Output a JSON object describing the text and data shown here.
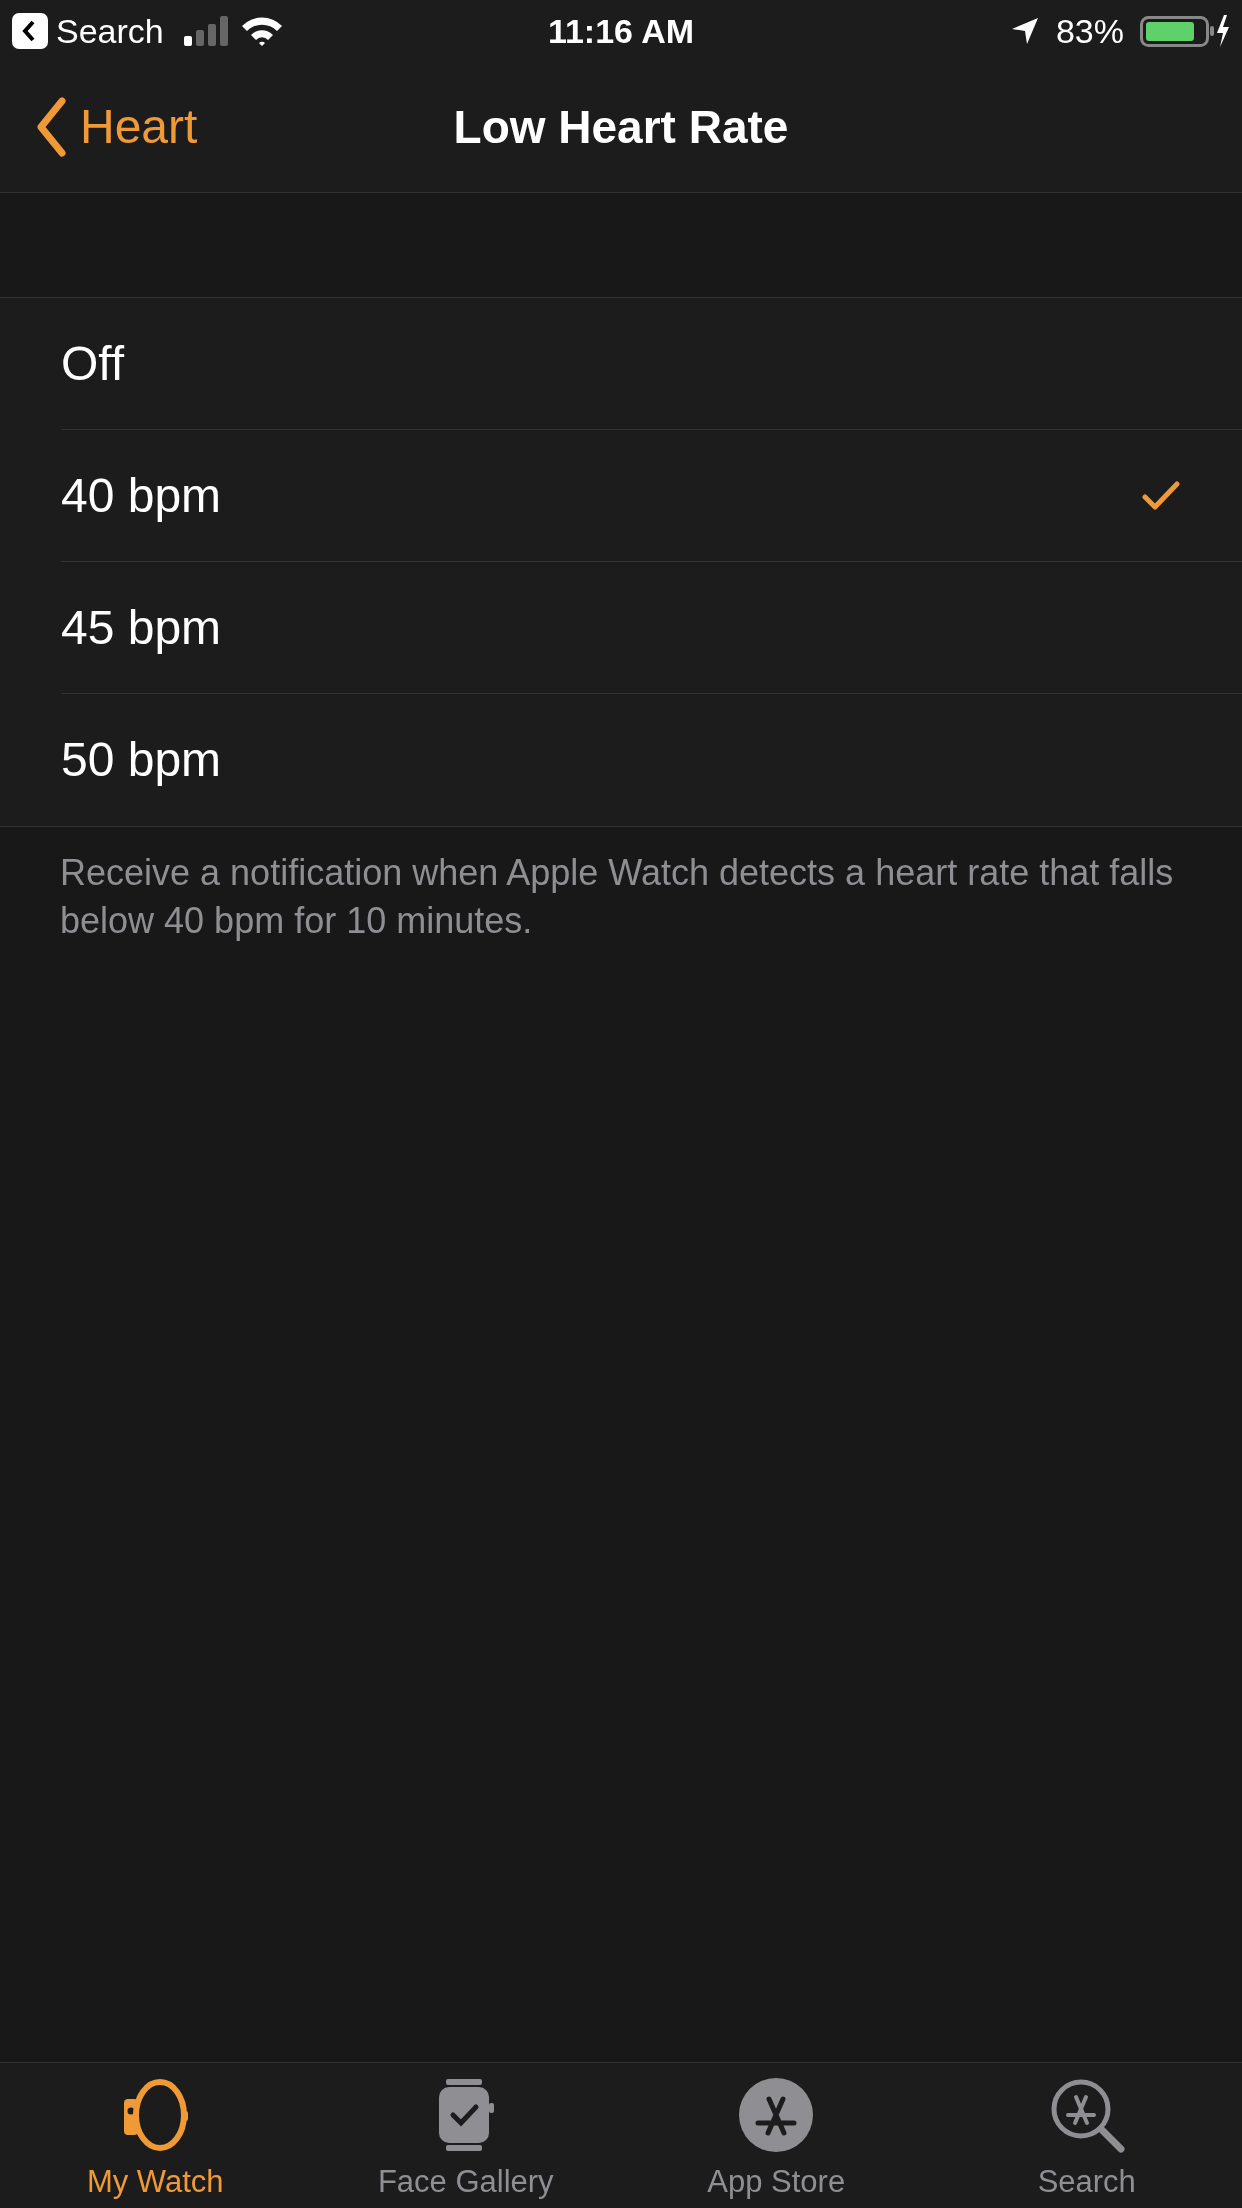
{
  "status_bar": {
    "back_label": "Search",
    "time": "11:16 AM",
    "battery": "83%"
  },
  "nav": {
    "back": "Heart",
    "title": "Low Heart Rate"
  },
  "options": [
    {
      "label": "Off",
      "selected": false
    },
    {
      "label": "40 bpm",
      "selected": true
    },
    {
      "label": "45 bpm",
      "selected": false
    },
    {
      "label": "50 bpm",
      "selected": false
    }
  ],
  "footer": "Receive a notification when Apple Watch detects a heart rate that falls below 40 bpm for 10 minutes.",
  "tabs": [
    {
      "label": "My Watch",
      "selected": true
    },
    {
      "label": "Face Gallery",
      "selected": false
    },
    {
      "label": "App Store",
      "selected": false
    },
    {
      "label": "Search",
      "selected": false
    }
  ]
}
